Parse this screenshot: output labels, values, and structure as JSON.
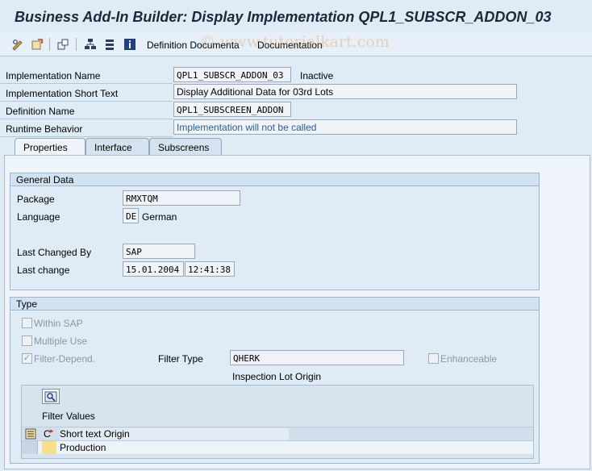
{
  "title": "Business Add-In Builder: Display Implementation QPL1_SUBSCR_ADDON_03",
  "watermark": "© www.tutorialkart.com",
  "toolbar": {
    "icons": [
      "pencil-glasses-icon",
      "activate-icon",
      "other-object-icon",
      "hierarchy-icon",
      "list-icon",
      "info-icon"
    ],
    "definition_documentation_label": "Definition Documenta",
    "documentation_label": "Documentation"
  },
  "header": {
    "implementation_name": {
      "label": "Implementation Name",
      "value": "QPL1_SUBSCR_ADDON_03",
      "status": "Inactive"
    },
    "short_text": {
      "label": "Implementation Short Text",
      "value": "Display Additional Data for 03rd Lots"
    },
    "definition_name": {
      "label": "Definition Name",
      "value": "QPL1_SUBSCREEN_ADDON"
    },
    "runtime_behavior": {
      "label": "Runtime Behavior",
      "value": "Implementation will not be called"
    }
  },
  "tabs": [
    {
      "label": "Properties",
      "active": true
    },
    {
      "label": "Interface",
      "active": false
    },
    {
      "label": "Subscreens",
      "active": false
    }
  ],
  "general_data": {
    "heading": "General Data",
    "package": {
      "label": "Package",
      "value": "RMXTQM"
    },
    "language": {
      "label": "Language",
      "code": "DE",
      "name": "German"
    },
    "last_changed_by": {
      "label": "Last Changed By",
      "value": "SAP"
    },
    "last_change": {
      "label": "Last change",
      "date": "15.01.2004",
      "time": "12:41:38"
    }
  },
  "type_group": {
    "heading": "Type",
    "within_sap": {
      "label": "Within SAP",
      "checked": false
    },
    "multiple_use": {
      "label": "Multiple Use",
      "checked": false
    },
    "filter_depend": {
      "label": "Filter-Depend.",
      "checked": true
    },
    "filter_type": {
      "label": "Filter Type",
      "value": "QHERK",
      "description": "Inspection Lot Origin"
    },
    "enhanceable": {
      "label": "Enhanceable",
      "checked": false
    }
  },
  "filter_values": {
    "heading": "Filter Values",
    "columns": [
      "C",
      "Short text Origin"
    ],
    "rows": [
      {
        "code": "",
        "text": "Production"
      }
    ]
  }
}
